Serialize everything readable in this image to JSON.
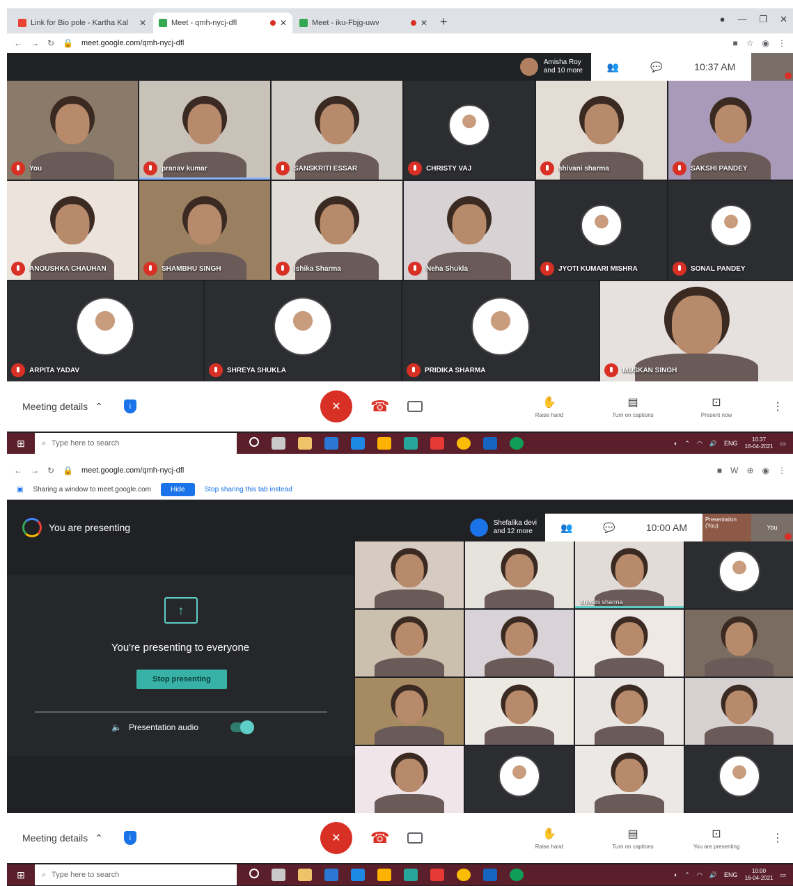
{
  "colors": {
    "meet_bg": "#202124",
    "mic_off": "#d93025",
    "accent_teal": "#38b2a7",
    "taskbar": "#5a1f2a"
  },
  "screenshot1": {
    "tabs": [
      {
        "title": "Link for Bio pole - Kartha Kal",
        "favicon": "gmail-icon"
      },
      {
        "title": "Meet - qmh-nycj-dfl",
        "favicon": "meet-icon"
      },
      {
        "title": "Meet - iku-Fbjg-uwv",
        "favicon": "meet-icon"
      }
    ],
    "url": "meet.google.com/qmh-nycj-dfl",
    "presenter_info": "Amisha Roy\nand 10 more",
    "clock": "10:37 AM",
    "participants": [
      {
        "name": "You"
      },
      {
        "name": "pranav kumar"
      },
      {
        "name": "SANSKRITI ESSAR"
      },
      {
        "name": "CHRISTY VAJ"
      },
      {
        "name": "shivani sharma"
      },
      {
        "name": "SAKSHI PANDEY"
      },
      {
        "name": "ANOUSHKA CHAUHAN"
      },
      {
        "name": "SHAMBHU SINGH"
      },
      {
        "name": "Ishika Sharma"
      },
      {
        "name": "Neha Shukla"
      },
      {
        "name": "JYOTI KUMARI MISHRA"
      },
      {
        "name": "SONAL PANDEY"
      },
      {
        "name": "ARPITA YADAV"
      },
      {
        "name": "SHREYA SHUKLA"
      },
      {
        "name": "PRIDIKA SHARMA"
      },
      {
        "name": "MUSKAN SINGH"
      }
    ],
    "bottom": {
      "meeting_details": "Meeting details",
      "raise_hand": "Raise hand",
      "captions": "Turn on captions",
      "present": "Present now"
    },
    "taskbar": {
      "search": "Type here to search",
      "time": "10:37",
      "date": "16-04-2021",
      "lang": "ENG"
    }
  },
  "screenshot2": {
    "url": "meet.google.com/qmh-nycj-dfl",
    "sharing_notice": "Sharing a window to meet.google.com",
    "hide_label": "Hide",
    "stop_sharing_link": "Stop sharing this tab instead",
    "you_are_presenting": "You are presenting",
    "presenter_info": "Shefalika devi\nand 12 more",
    "clock": "10:00 AM",
    "presentation_tag": "Presentation\n(You)",
    "self_label": "You",
    "presenting_to_everyone": "You're presenting to everyone",
    "stop_presenting": "Stop presenting",
    "presentation_audio": "Presentation audio",
    "speaker_name": "shivani sharma",
    "bottom": {
      "meeting_details": "Meeting details",
      "raise_hand": "Raise hand",
      "captions": "Turn on captions",
      "present": "You are presenting"
    },
    "taskbar": {
      "search": "Type here to search",
      "time": "10:00",
      "date": "16-04-2021",
      "lang": "ENG"
    }
  }
}
